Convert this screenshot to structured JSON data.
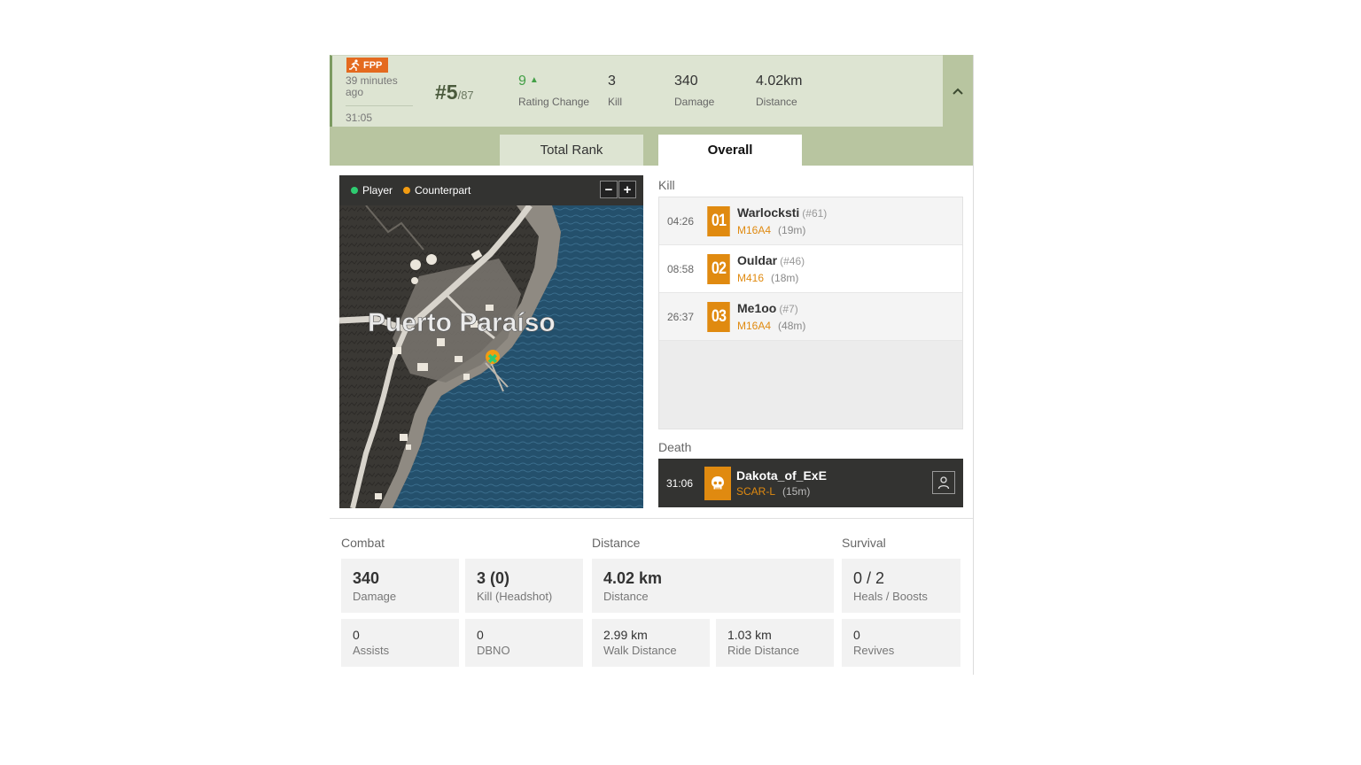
{
  "match": {
    "mode_badge": "FPP",
    "time_ago": "39 minutes ago",
    "duration": "31:05",
    "rank": "#5",
    "rank_total": "/87",
    "stats": [
      {
        "value": "9",
        "label": "Rating Change"
      },
      {
        "value": "3",
        "label": "Kill"
      },
      {
        "value": "340",
        "label": "Damage"
      },
      {
        "value": "4.02km",
        "label": "Distance"
      }
    ]
  },
  "tabs": [
    {
      "label": "Total Rank",
      "active": false
    },
    {
      "label": "Overall",
      "active": true
    }
  ],
  "map": {
    "legend_player": "Player",
    "legend_counterpart": "Counterpart",
    "zoom_out": "−",
    "zoom_in": "+",
    "location_name": "Puerto Paraíso",
    "colors": {
      "player": "#2ecc71",
      "counterpart": "#f39c12",
      "sea": "#2a5a78",
      "land": "#3d3a36"
    }
  },
  "kill_section": {
    "label": "Kill",
    "kills": [
      {
        "time": "04:26",
        "num": "01",
        "name": "Warlocksti",
        "rank": "(#61)",
        "weapon": "M16A4",
        "distance": "(19m)"
      },
      {
        "time": "08:58",
        "num": "02",
        "name": "Ouldar",
        "rank": "(#46)",
        "weapon": "M416",
        "distance": "(18m)"
      },
      {
        "time": "26:37",
        "num": "03",
        "name": "Me1oo",
        "rank": "(#7)",
        "weapon": "M16A4",
        "distance": "(48m)"
      }
    ]
  },
  "death_section": {
    "label": "Death",
    "time": "31:06",
    "killer": "Dakota_of_ExE",
    "weapon": "SCAR-L",
    "distance": "(15m)",
    "icon": "skull-icon"
  },
  "summary": {
    "combat_label": "Combat",
    "distance_label": "Distance",
    "survival_label": "Survival",
    "damage": {
      "value": "340",
      "label": "Damage"
    },
    "kills": {
      "value": "3 (0)",
      "label": "Kill (Headshot)"
    },
    "distance": {
      "value": "4.02 km",
      "label": "Distance"
    },
    "heals": {
      "value": "0 / 2",
      "label": "Heals / Boosts"
    },
    "assists": {
      "value": "0",
      "label": "Assists"
    },
    "dbno": {
      "value": "0",
      "label": "DBNO"
    },
    "walk": {
      "value": "2.99 km",
      "label": "Walk Distance"
    },
    "ride": {
      "value": "1.03 km",
      "label": "Ride Distance"
    },
    "revives": {
      "value": "0",
      "label": "Revives"
    }
  },
  "theme": {
    "accent_green": "#7d9b62",
    "header_bg": "#dde4d2",
    "tab_bg": "#b8c5a0",
    "orange": "#e08a10",
    "rating_up": "#43a047"
  }
}
